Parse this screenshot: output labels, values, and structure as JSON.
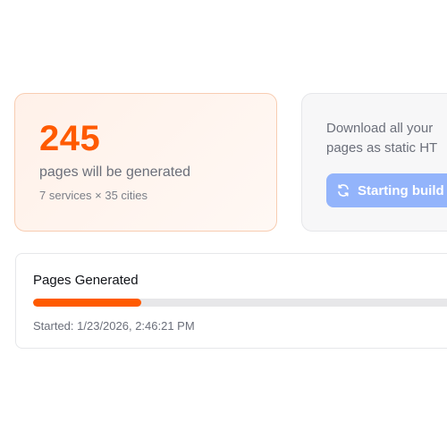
{
  "stats": {
    "count": "245",
    "label": "pages will be generated",
    "detail": "7 services × 35 cities"
  },
  "download": {
    "line1": "Download all your",
    "line2": "pages as static HT",
    "button_label": "Starting build",
    "button_icon": "refresh-icon",
    "button_color": "#93b4fb"
  },
  "progress": {
    "title": "Pages Generated",
    "fraction": 0.258,
    "started": "Started: 1/23/2026, 2:46:21 PM",
    "fill_color": "#ff5a00"
  }
}
